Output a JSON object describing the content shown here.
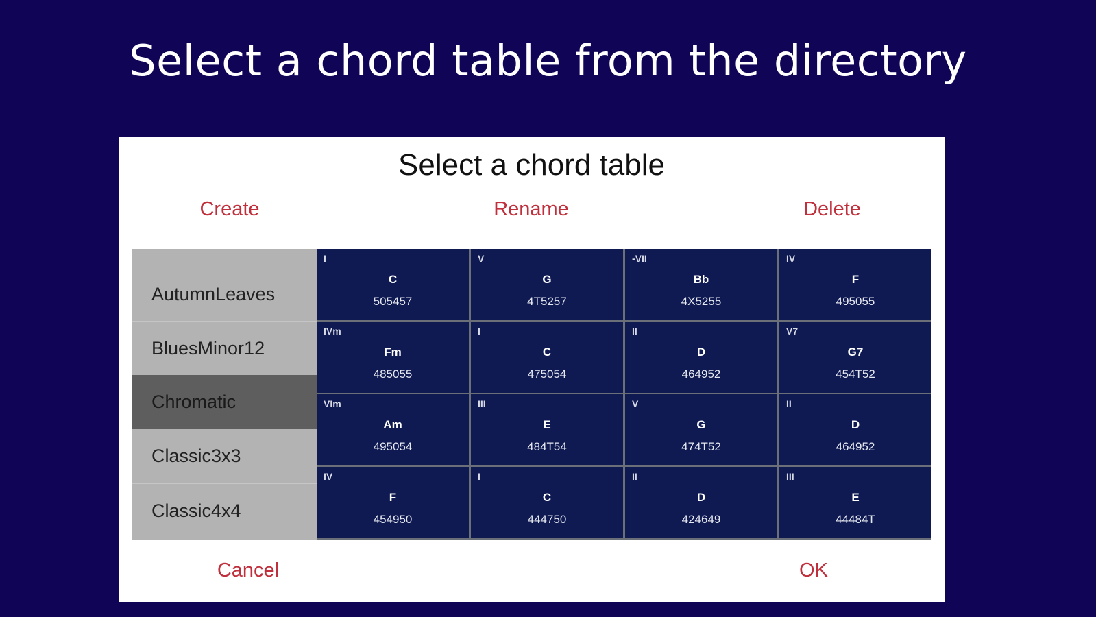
{
  "page_heading": "Select a chord table from the directory",
  "dialog": {
    "title": "Select a chord table",
    "actions": {
      "create": "Create",
      "rename": "Rename",
      "delete": "Delete",
      "cancel": "Cancel",
      "ok": "OK"
    },
    "tables": [
      "AutumnLeaves",
      "BluesMinor12",
      "Chromatic",
      "Classic3x3",
      "Classic4x4"
    ],
    "selected_table": "Chromatic",
    "grid": [
      [
        {
          "degree": "I",
          "chord": "C",
          "fret": "505457"
        },
        {
          "degree": "V",
          "chord": "G",
          "fret": "4T5257"
        },
        {
          "degree": "-VII",
          "chord": "Bb",
          "fret": "4X5255"
        },
        {
          "degree": "IV",
          "chord": "F",
          "fret": "495055"
        }
      ],
      [
        {
          "degree": "IVm",
          "chord": "Fm",
          "fret": "485055"
        },
        {
          "degree": "I",
          "chord": "C",
          "fret": "475054"
        },
        {
          "degree": "II",
          "chord": "D",
          "fret": "464952"
        },
        {
          "degree": "V7",
          "chord": "G7",
          "fret": "454T52"
        }
      ],
      [
        {
          "degree": "VIm",
          "chord": "Am",
          "fret": "495054"
        },
        {
          "degree": "III",
          "chord": "E",
          "fret": "484T54"
        },
        {
          "degree": "V",
          "chord": "G",
          "fret": "474T52"
        },
        {
          "degree": "II",
          "chord": "D",
          "fret": "464952"
        }
      ],
      [
        {
          "degree": "IV",
          "chord": "F",
          "fret": "454950"
        },
        {
          "degree": "I",
          "chord": "C",
          "fret": "444750"
        },
        {
          "degree": "II",
          "chord": "D",
          "fret": "424649"
        },
        {
          "degree": "III",
          "chord": "E",
          "fret": "44484T"
        }
      ]
    ]
  },
  "colors": {
    "page_background": "#0f0456",
    "dialog_background": "#ffffff",
    "action_text": "#c0303c",
    "list_background": "#b3b3b3",
    "list_selected": "#5e5e5e",
    "cell_background": "#0f1a52",
    "cell_text": "#ffffff"
  }
}
